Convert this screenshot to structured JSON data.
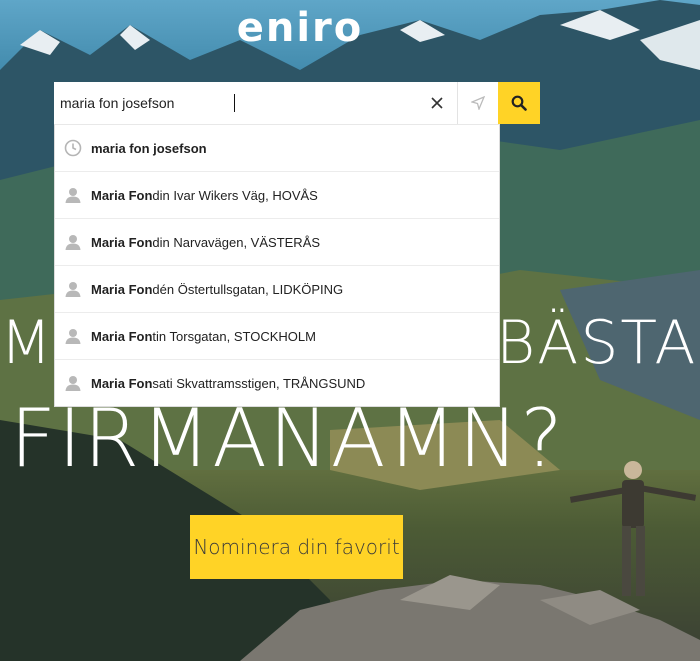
{
  "brand": {
    "logo_text": "eniro"
  },
  "search": {
    "value": "maria fon josefson",
    "placeholder": ""
  },
  "suggestions": [
    {
      "icon": "clock-icon",
      "bold": "maria fon josefson",
      "rest": ""
    },
    {
      "icon": "person-icon",
      "bold": "Maria Fon",
      "rest": "din Ivar Wikers Väg, HOVÅS"
    },
    {
      "icon": "person-icon",
      "bold": "Maria Fon",
      "rest": "din Narvavägen, VÄSTERÅS"
    },
    {
      "icon": "person-icon",
      "bold": "Maria Fon",
      "rest": "dén Östertullsgatan, LIDKÖPING"
    },
    {
      "icon": "person-icon",
      "bold": "Maria Fon",
      "rest": "tin Torsgatan, STOCKHOLM"
    },
    {
      "icon": "person-icon",
      "bold": "Maria Fon",
      "rest": "sati Skvattramsstigen, TRÅNGSUND"
    }
  ],
  "hero": {
    "line1_left": "M",
    "line1_right": "BÄSTA",
    "line2": "FIRMANAMN?"
  },
  "cta": {
    "label": "Nominera din favorit"
  },
  "colors": {
    "accent": "#ffd326"
  }
}
